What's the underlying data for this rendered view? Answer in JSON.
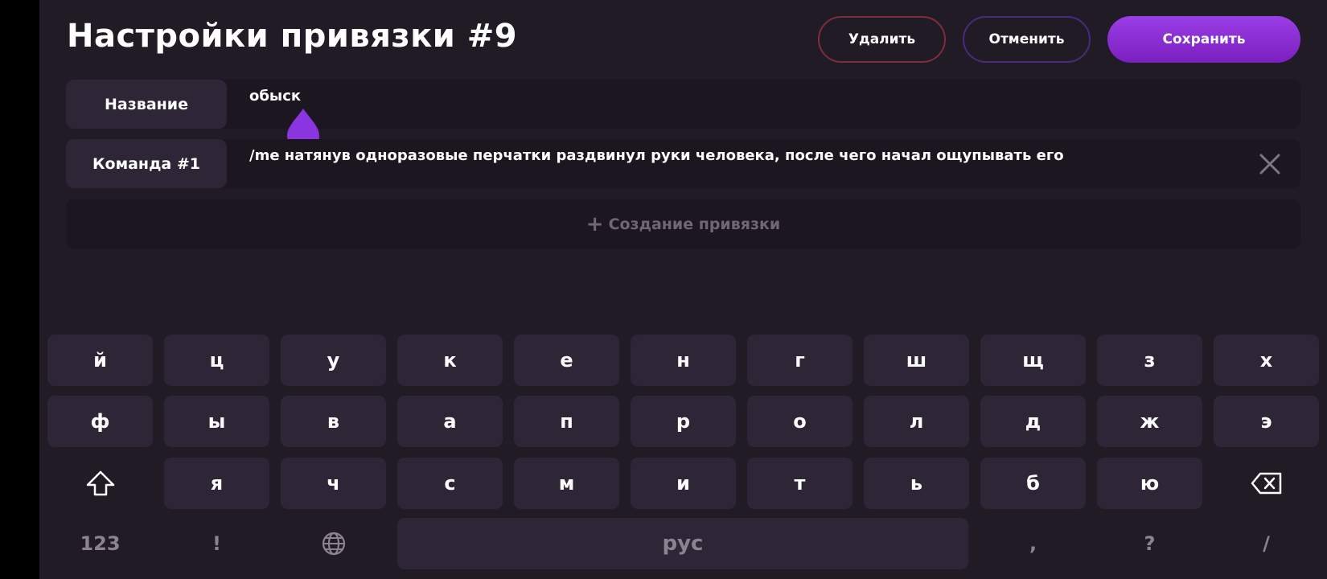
{
  "header": {
    "title": "Настройки привязки #9",
    "delete_label": "Удалить",
    "cancel_label": "Отменить",
    "save_label": "Сохранить"
  },
  "fields": {
    "name": {
      "label": "Название",
      "value": "обыск"
    },
    "command": {
      "label": "Команда #1",
      "value": "/me натянув одноразовые перчатки раздвинул руки человека, после чего начал ощупывать его"
    }
  },
  "create_binding": {
    "plus": "+",
    "label": "Создание привязки"
  },
  "keyboard": {
    "row1": [
      "й",
      "ц",
      "у",
      "к",
      "е",
      "н",
      "г",
      "ш",
      "щ",
      "з",
      "х"
    ],
    "row2": [
      "ф",
      "ы",
      "в",
      "а",
      "п",
      "р",
      "о",
      "л",
      "д",
      "ж",
      "э"
    ],
    "row3": [
      "я",
      "ч",
      "с",
      "м",
      "и",
      "т",
      "ь",
      "б",
      "ю"
    ],
    "numbers_key": "123",
    "exclaim_key": "!",
    "space_label": "рус",
    "comma_key": ",",
    "question_key": "?",
    "slash_key": "/",
    "icons": {
      "shift": "shift-icon",
      "backspace": "backspace-icon",
      "globe": "globe-icon"
    }
  },
  "colors": {
    "background": "#211b26",
    "key": "#2e2536",
    "accent": "#8a2fd6",
    "delete_border": "#7c2f3a",
    "cancel_border": "#4b2a7c"
  }
}
